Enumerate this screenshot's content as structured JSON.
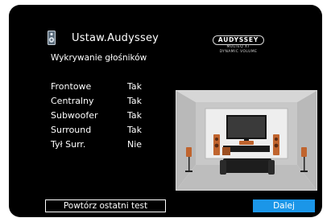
{
  "header": {
    "title": "Ustaw.Audyssey",
    "speaker_icon": "speaker-icon"
  },
  "subtitle": "Wykrywanie głośników",
  "logo": {
    "brand": "AUDYSSEY",
    "line1": "MULTEQ XT",
    "line2": "DYNAMIC VOLUME"
  },
  "speakers": [
    {
      "label": "Frontowe",
      "value": "Tak"
    },
    {
      "label": "Centralny",
      "value": "Tak"
    },
    {
      "label": "Subwoofer",
      "value": "Tak"
    },
    {
      "label": "Surround",
      "value": "Tak"
    },
    {
      "label": "Tył Surr.",
      "value": "Nie"
    }
  ],
  "buttons": {
    "retest": "Powtórz ostatni test",
    "next": "Dalej"
  },
  "colors": {
    "accent": "#1b96e8",
    "background": "#000000",
    "speaker_wood": "#c0642e"
  },
  "illustration": "living-room-speaker-layout-image"
}
